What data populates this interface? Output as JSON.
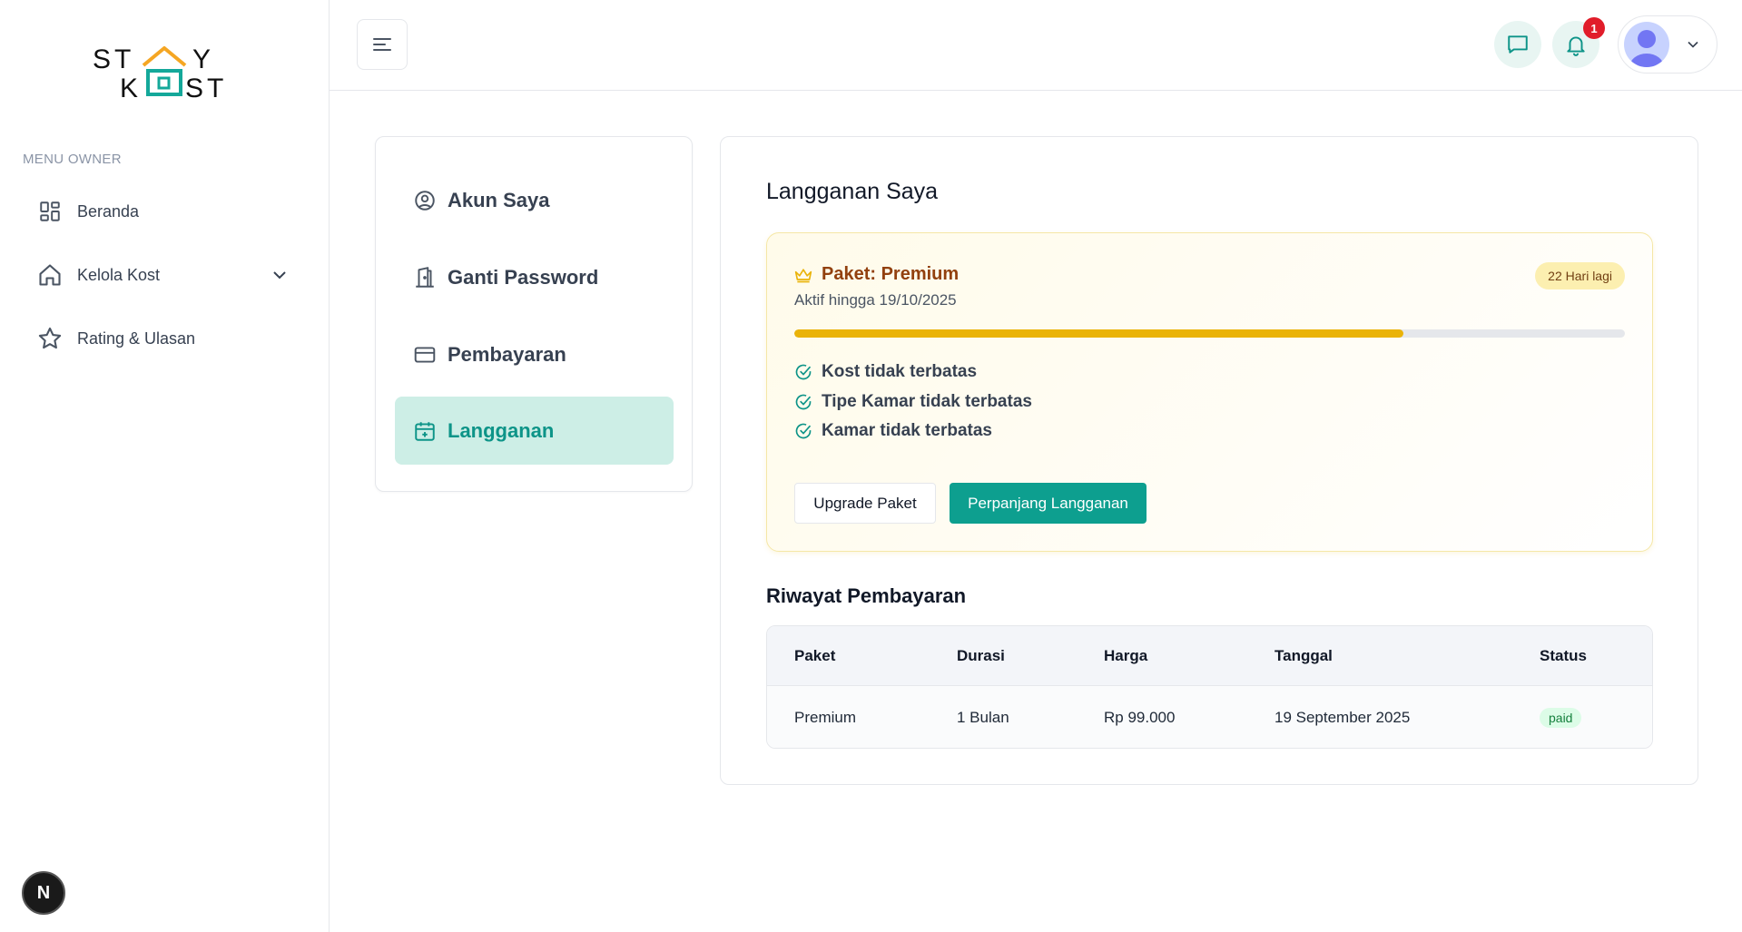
{
  "brand": {
    "logo_line1": "ST  Y",
    "logo_line2": "K  ST"
  },
  "sidebar": {
    "menu_title": "MENU OWNER",
    "items": [
      {
        "label": "Beranda",
        "icon": "dashboard-icon"
      },
      {
        "label": "Kelola Kost",
        "icon": "home-icon",
        "has_dropdown": true
      },
      {
        "label": "Rating & Ulasan",
        "icon": "star-icon"
      }
    ]
  },
  "header": {
    "notification_count": "1"
  },
  "settings_menu": {
    "items": [
      {
        "label": "Akun Saya",
        "icon": "user-circle-icon",
        "active": false
      },
      {
        "label": "Ganti Password",
        "icon": "door-icon",
        "active": false
      },
      {
        "label": "Pembayaran",
        "icon": "credit-card-icon",
        "active": false
      },
      {
        "label": "Langganan",
        "icon": "calendar-icon",
        "active": true
      }
    ]
  },
  "subscription": {
    "title": "Langganan Saya",
    "plan_label": "Paket: Premium",
    "active_until": "Aktif hingga 19/10/2025",
    "days_left": "22 Hari lagi",
    "progress_fraction": 0.733,
    "features": [
      "Kost tidak terbatas",
      "Tipe Kamar tidak terbatas",
      "Kamar tidak terbatas"
    ],
    "upgrade_label": "Upgrade Paket",
    "extend_label": "Perpanjang Langganan"
  },
  "payment_history": {
    "title": "Riwayat Pembayaran",
    "columns": [
      "Paket",
      "Durasi",
      "Harga",
      "Tanggal",
      "Status"
    ],
    "rows": [
      {
        "paket": "Premium",
        "durasi": "1 Bulan",
        "harga": "Rp 99.000",
        "tanggal": "19 September 2025",
        "status": "paid"
      }
    ]
  },
  "colors": {
    "accent": "#0d9f8f",
    "accent_soft": "#cdeee6",
    "premium": "#eab308",
    "logo_orange": "#f5a623",
    "logo_teal": "#14a89a",
    "notification_red": "#e11d2a"
  }
}
